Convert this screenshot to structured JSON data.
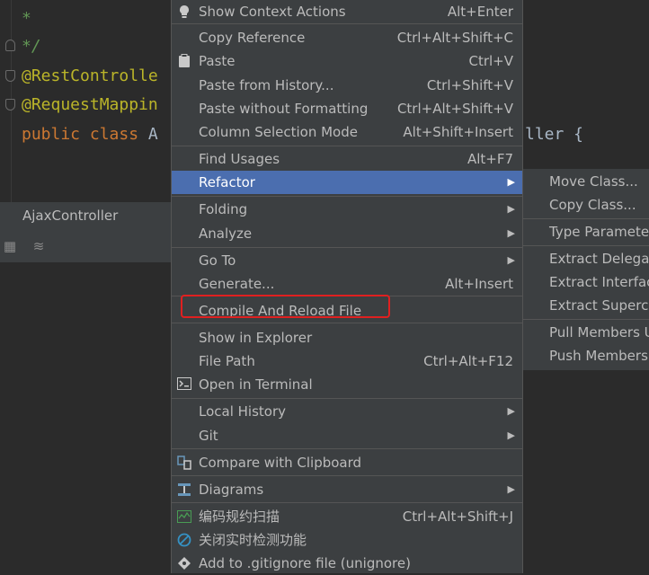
{
  "editor": {
    "lines": [
      {
        "text": " *",
        "kind": "comment"
      },
      {
        "text": " */",
        "kind": "comment"
      },
      {
        "text": "@RestControlle",
        "kind": "annot"
      },
      {
        "text": "@RequestMappin",
        "kind": "annot"
      }
    ],
    "class_line": {
      "kw": "public class ",
      "name": "A",
      "tail": "ller {"
    }
  },
  "tab": {
    "label": "AjaxController"
  },
  "menu": {
    "items": [
      {
        "label": "Show Context Actions",
        "shortcut": "Alt+Enter",
        "icon": "bulb-icon"
      },
      {
        "label": "Copy Reference",
        "shortcut": "Ctrl+Alt+Shift+C"
      },
      {
        "label": "Paste",
        "shortcut": "Ctrl+V",
        "icon": "clipboard-icon"
      },
      {
        "label": "Paste from History...",
        "shortcut": "Ctrl+Shift+V"
      },
      {
        "label": "Paste without Formatting",
        "shortcut": "Ctrl+Alt+Shift+V"
      },
      {
        "label": "Column Selection Mode",
        "shortcut": "Alt+Shift+Insert"
      },
      {
        "label": "Find Usages",
        "shortcut": "Alt+F7"
      },
      {
        "label": "Refactor",
        "submenu": true
      },
      {
        "label": "Folding",
        "submenu": true
      },
      {
        "label": "Analyze",
        "submenu": true
      },
      {
        "label": "Go To",
        "submenu": true
      },
      {
        "label": "Generate...",
        "shortcut": "Alt+Insert"
      },
      {
        "label": "Compile And Reload File"
      },
      {
        "label": "Show in Explorer"
      },
      {
        "label": "File Path",
        "shortcut": "Ctrl+Alt+F12"
      },
      {
        "label": "Open in Terminal",
        "icon": "terminal-icon"
      },
      {
        "label": "Local History",
        "submenu": true
      },
      {
        "label": "Git",
        "submenu": true
      },
      {
        "label": "Compare with Clipboard",
        "icon": "compare-icon"
      },
      {
        "label": "Diagrams",
        "submenu": true,
        "icon": "diagram-icon"
      },
      {
        "label": "编码规约扫描",
        "shortcut": "Ctrl+Alt+Shift+J",
        "icon": "scan-icon"
      },
      {
        "label": "关闭实时检测功能",
        "icon": "block-icon"
      },
      {
        "label": "Add to .gitignore file (unignore)",
        "icon": "gitignore-icon"
      }
    ]
  },
  "submenu": {
    "items": [
      {
        "label": "Move Class..."
      },
      {
        "label": "Copy Class..."
      },
      {
        "label": "Type Parameter"
      },
      {
        "label": "Extract Delegat"
      },
      {
        "label": "Extract Interfac"
      },
      {
        "label": "Extract Supercla"
      },
      {
        "label": "Pull Members U"
      },
      {
        "label": "Push Members"
      }
    ]
  },
  "colors": {
    "selection": "#4b6eaf",
    "highlight_box": "#e02020",
    "menu_bg": "#3c3f41"
  }
}
